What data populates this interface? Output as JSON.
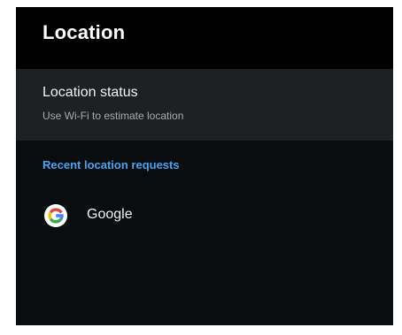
{
  "header": {
    "title": "Location"
  },
  "location_status": {
    "title": "Location status",
    "subtitle": "Use Wi-Fi to estimate location"
  },
  "recent_requests": {
    "section_title": "Recent location requests",
    "items": [
      {
        "label": "Google",
        "icon": "google-g-icon"
      }
    ]
  },
  "colors": {
    "background": "#0a0d10",
    "header_background": "#000000",
    "selected_row_background": "#1d2124",
    "accent": "#4aa3f0",
    "primary_text": "#f2f2f2",
    "secondary_text": "#a8abaf"
  }
}
